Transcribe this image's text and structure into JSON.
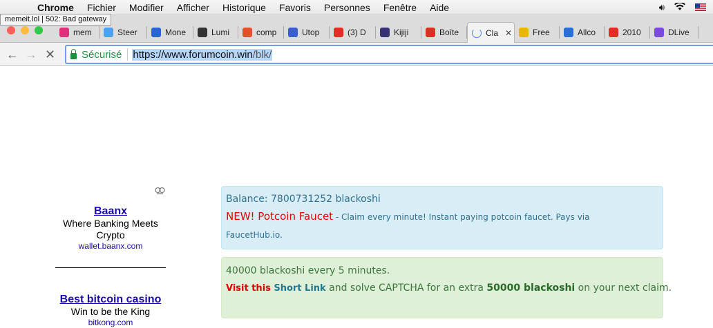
{
  "menubar": {
    "items": [
      "Chrome",
      "Fichier",
      "Modifier",
      "Afficher",
      "Historique",
      "Favoris",
      "Personnes",
      "Fenêtre",
      "Aide"
    ]
  },
  "tooltip": "memeit.lol | 502: Bad gateway",
  "tabs": [
    {
      "label": "mem",
      "icon": "memeit-icon",
      "color": "#e0307a"
    },
    {
      "label": "Steer",
      "icon": "steem-icon",
      "color": "#4ba2f2"
    },
    {
      "label": "Mone",
      "icon": "monetha-icon",
      "color": "#2a63d6"
    },
    {
      "label": "Lumi",
      "icon": "lightning-icon",
      "color": "#333333"
    },
    {
      "label": "comp",
      "icon": "dtube-icon",
      "color": "#e0522a"
    },
    {
      "label": "Utop",
      "icon": "eye-icon",
      "color": "#3a5fcd"
    },
    {
      "label": "(3) D",
      "icon": "youtube-icon",
      "color": "#e52d27"
    },
    {
      "label": "Kijiji",
      "icon": "kijiji-icon",
      "color": "#373373"
    },
    {
      "label": "Boîte",
      "icon": "gmail-icon",
      "color": "#d93025"
    },
    {
      "label": "Cla",
      "icon": "loading-icon",
      "color": "#ffffff"
    },
    {
      "label": "Free",
      "icon": "smiley-icon",
      "color": "#e8b800"
    },
    {
      "label": "Allco",
      "icon": "allcoins-icon",
      "color": "#2a6fd6"
    },
    {
      "label": "2010",
      "icon": "play-icon",
      "color": "#e52d27"
    },
    {
      "label": "DLive",
      "icon": "dlive-icon",
      "color": "#7b4be0"
    }
  ],
  "address": {
    "secure_label": "Sécurisé",
    "url_host": "https://www.forumcoin.win",
    "url_path": "/blk/"
  },
  "ads": [
    {
      "title": "Baanx",
      "desc": "Where Banking Meets Crypto",
      "domain": "wallet.baanx.com"
    },
    {
      "title": "Best bitcoin casino",
      "desc": "Win to be the King",
      "domain": "bitkong.com"
    }
  ],
  "info_panel": {
    "balance": "Balance: 7800731252 blackoshi",
    "new_title": "NEW! Potcoin Faucet",
    "new_desc": " - Claim every minute! Instant paying potcoin faucet. Pays via",
    "hub": "FaucetHub.io."
  },
  "success_panel": {
    "rate": "40000 blackoshi every 5 minutes.",
    "visit": "Visit this",
    "short_link": "Short Link",
    "mid": " and solve CAPTCHA for an extra ",
    "bonus": "50000 blackoshi",
    "tail": " on your next claim."
  }
}
